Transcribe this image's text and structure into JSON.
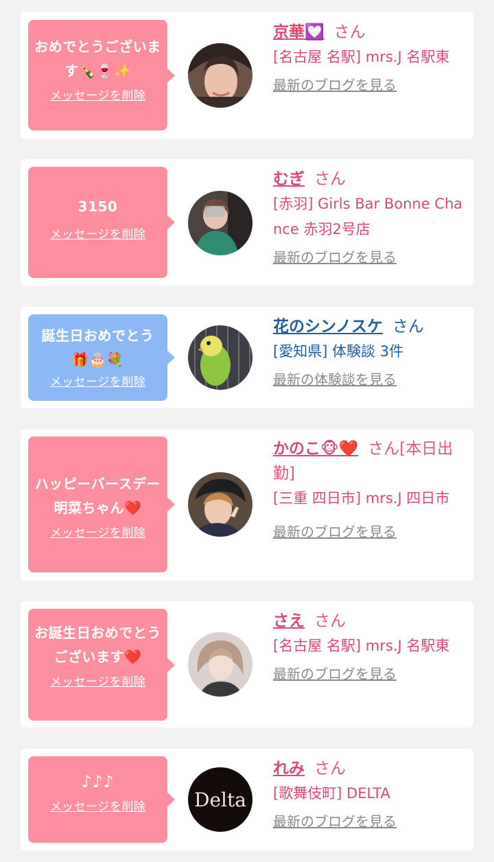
{
  "items": [
    {
      "message": "おめでとうございます🍾🍷✨",
      "delete_label": "メッセージを削除",
      "name": "京華💟",
      "honorific": "さん",
      "location": "[名古屋 名駅] mrs.J 名駅東",
      "link_label": "最新のブログを見る",
      "bubble_color": "#fc8e9f",
      "avatar_desc": "woman-photo"
    },
    {
      "message": "3150",
      "delete_label": "メッセージを削除",
      "name": "むぎ",
      "honorific": "さん",
      "location": "[赤羽] Girls Bar Bonne Chance 赤羽2号店",
      "link_label": "最新のブログを見る",
      "bubble_color": "#fc8e9f",
      "avatar_desc": "woman-photo"
    },
    {
      "message": "誕生日おめでとう🎁🎂💐",
      "delete_label": "メッセージを削除",
      "name": "花のシンノスケ",
      "honorific": "さん",
      "location": "[愛知県] 体験談 3件",
      "link_label": "最新の体験談を見る",
      "bubble_color": "#8db8f6",
      "avatar_desc": "parakeet-photo"
    },
    {
      "message": "ハッピーバースデー明菜ちゃん❤️",
      "delete_label": "メッセージを削除",
      "name": "かのこ🐵❤️",
      "honorific": "さん[本日出勤]",
      "location": "[三重 四日市] mrs.J 四日市",
      "link_label": "最新のブログを見る",
      "bubble_color": "#fc8e9f",
      "avatar_desc": "woman-photo"
    },
    {
      "message": "お誕生日おめでとうございます❤️",
      "delete_label": "メッセージを削除",
      "name": "さえ",
      "honorific": "さん",
      "location": "[名古屋 名駅] mrs.J 名駅東",
      "link_label": "最新のブログを見る",
      "bubble_color": "#fc8e9f",
      "avatar_desc": "woman-photo"
    },
    {
      "message": "♪♪♪",
      "delete_label": "メッセージを削除",
      "name": "れみ",
      "honorific": "さん",
      "location": "[歌舞伎町] DELTA",
      "link_label": "最新のブログを見る",
      "bubble_color": "#fc8e9f",
      "avatar_desc": "delta-logo",
      "avatar_logo_text": "Delta"
    }
  ],
  "colors": {
    "background": "#f2f2f2",
    "card": "#ffffff",
    "pink_text": "#e0476e",
    "blue_text": "#1d5f9e",
    "link_gray": "#8a8a8a"
  }
}
